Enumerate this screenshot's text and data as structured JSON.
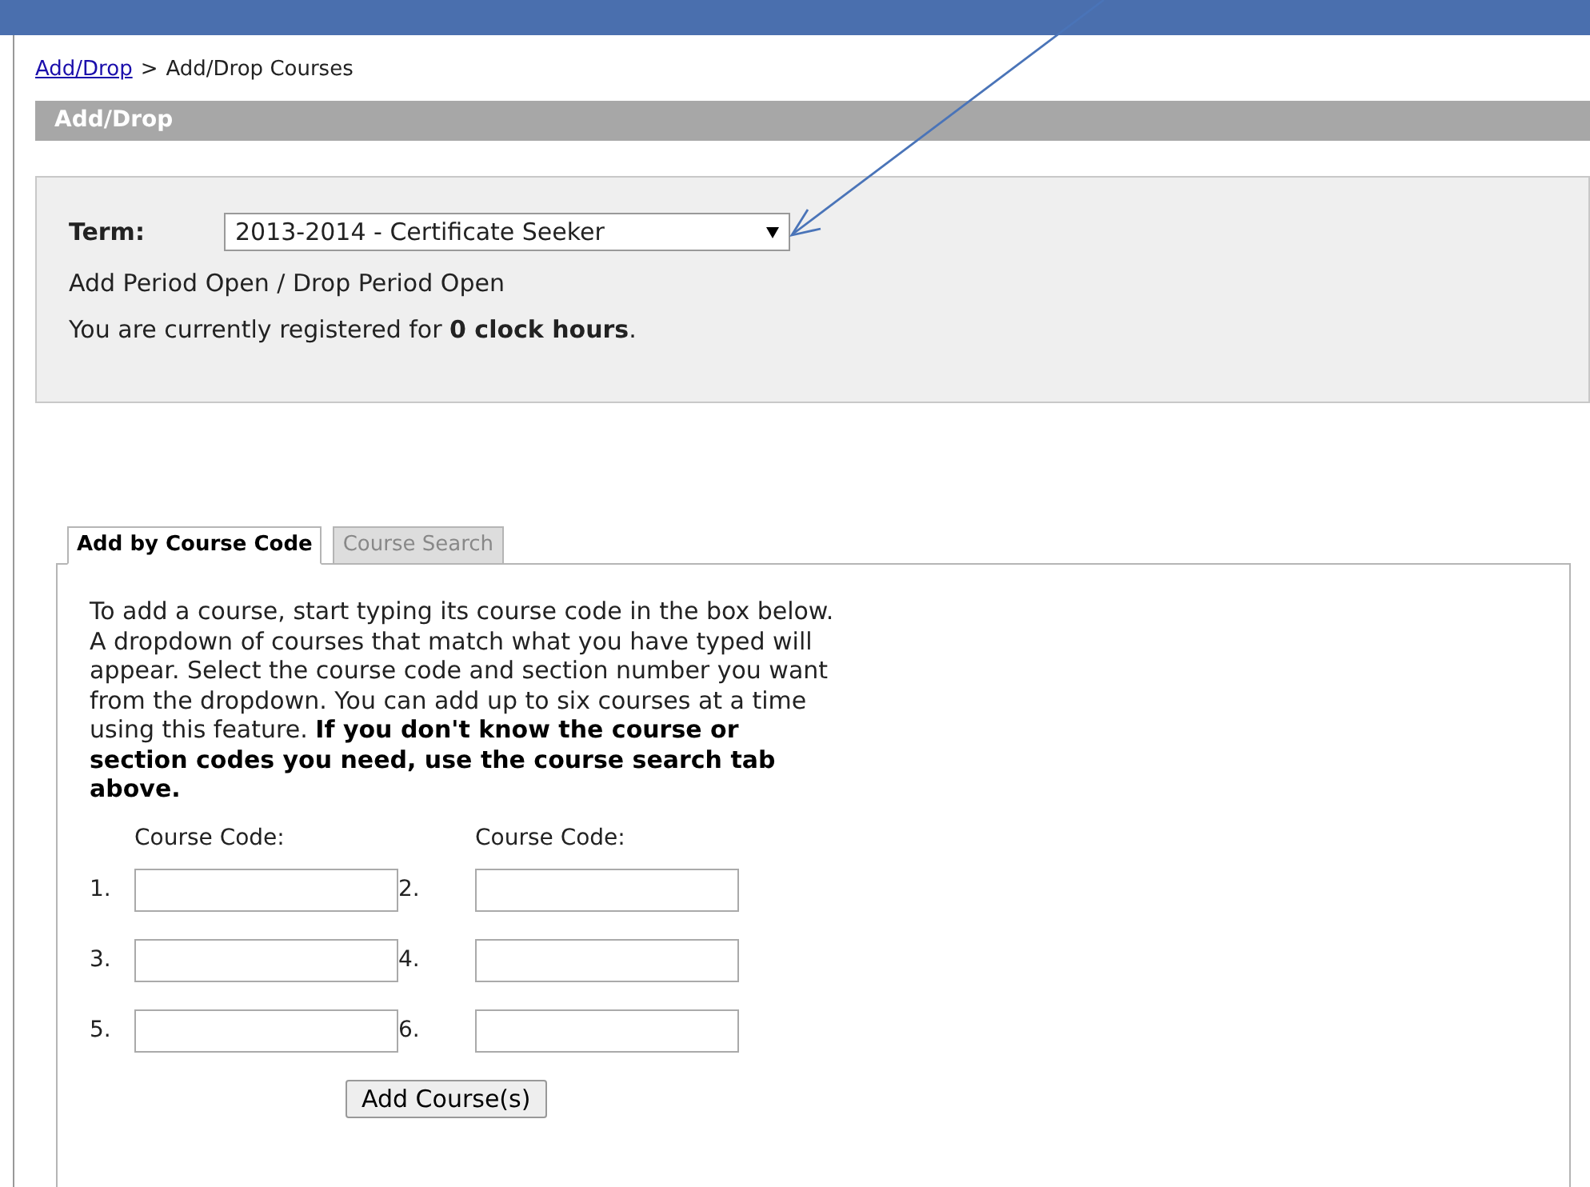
{
  "breadcrumb": {
    "link": "Add/Drop",
    "separator": ">",
    "current": "Add/Drop Courses"
  },
  "header": {
    "title": "Add/Drop"
  },
  "term": {
    "label": "Term:",
    "value": "2013-2014 - Certificate Seeker",
    "status": "Add Period Open / Drop Period Open",
    "registration": "You are currently registered for **0 clock hours**."
  },
  "tabs": [
    {
      "label": "Add by Course Code",
      "selected": true
    },
    {
      "label": "Course Search",
      "selected": false
    }
  ],
  "instructions": "To add a course, start typing its course code in the box below. A dropdown of courses that match what you have typed will appear. Select the course code and section number you want from the dropdown. You can add up to six courses at a time using this feature. **If you don't know the course or section codes you need, use the course search tab above.**",
  "course_code_headers": [
    "Course Code:",
    "Course Code:"
  ],
  "course_fields": [
    {
      "number": "1."
    },
    {
      "number": "2."
    },
    {
      "number": "3."
    },
    {
      "number": "4."
    },
    {
      "number": "5."
    },
    {
      "number": "6."
    }
  ],
  "add_button": "Add Course(s)"
}
